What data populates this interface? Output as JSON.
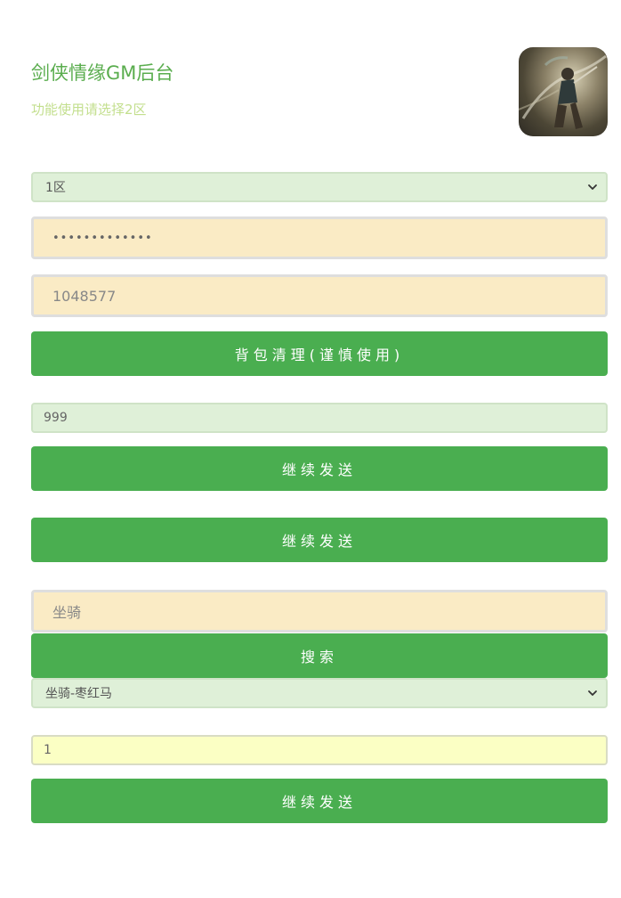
{
  "header": {
    "title": "剑侠情缘GM后台",
    "subtitle": "功能使用请选择2区"
  },
  "form": {
    "server_select": {
      "value": "1区"
    },
    "password_input": {
      "masked_value": "•••••••••••••"
    },
    "role_id_input": {
      "value": "1048577"
    },
    "clear_bag_button": "背包清理(谨慎使用)",
    "amount_input": {
      "value": "999"
    },
    "send_button_1": "继续发送",
    "send_button_2": "继续发送",
    "item_search_input": {
      "value": "坐骑"
    },
    "search_button": "搜索",
    "item_select": {
      "value": "坐骑-枣红马"
    },
    "item_count_input": {
      "value": "1"
    },
    "send_button_3": "继续发送"
  },
  "colors": {
    "accent_green": "#4aae50",
    "title_green": "#5aad4e",
    "subtitle_green": "#c3df8e",
    "input_orange": "#faebc5",
    "input_green": "#dff0d8",
    "input_yellow": "#fbffc4"
  }
}
